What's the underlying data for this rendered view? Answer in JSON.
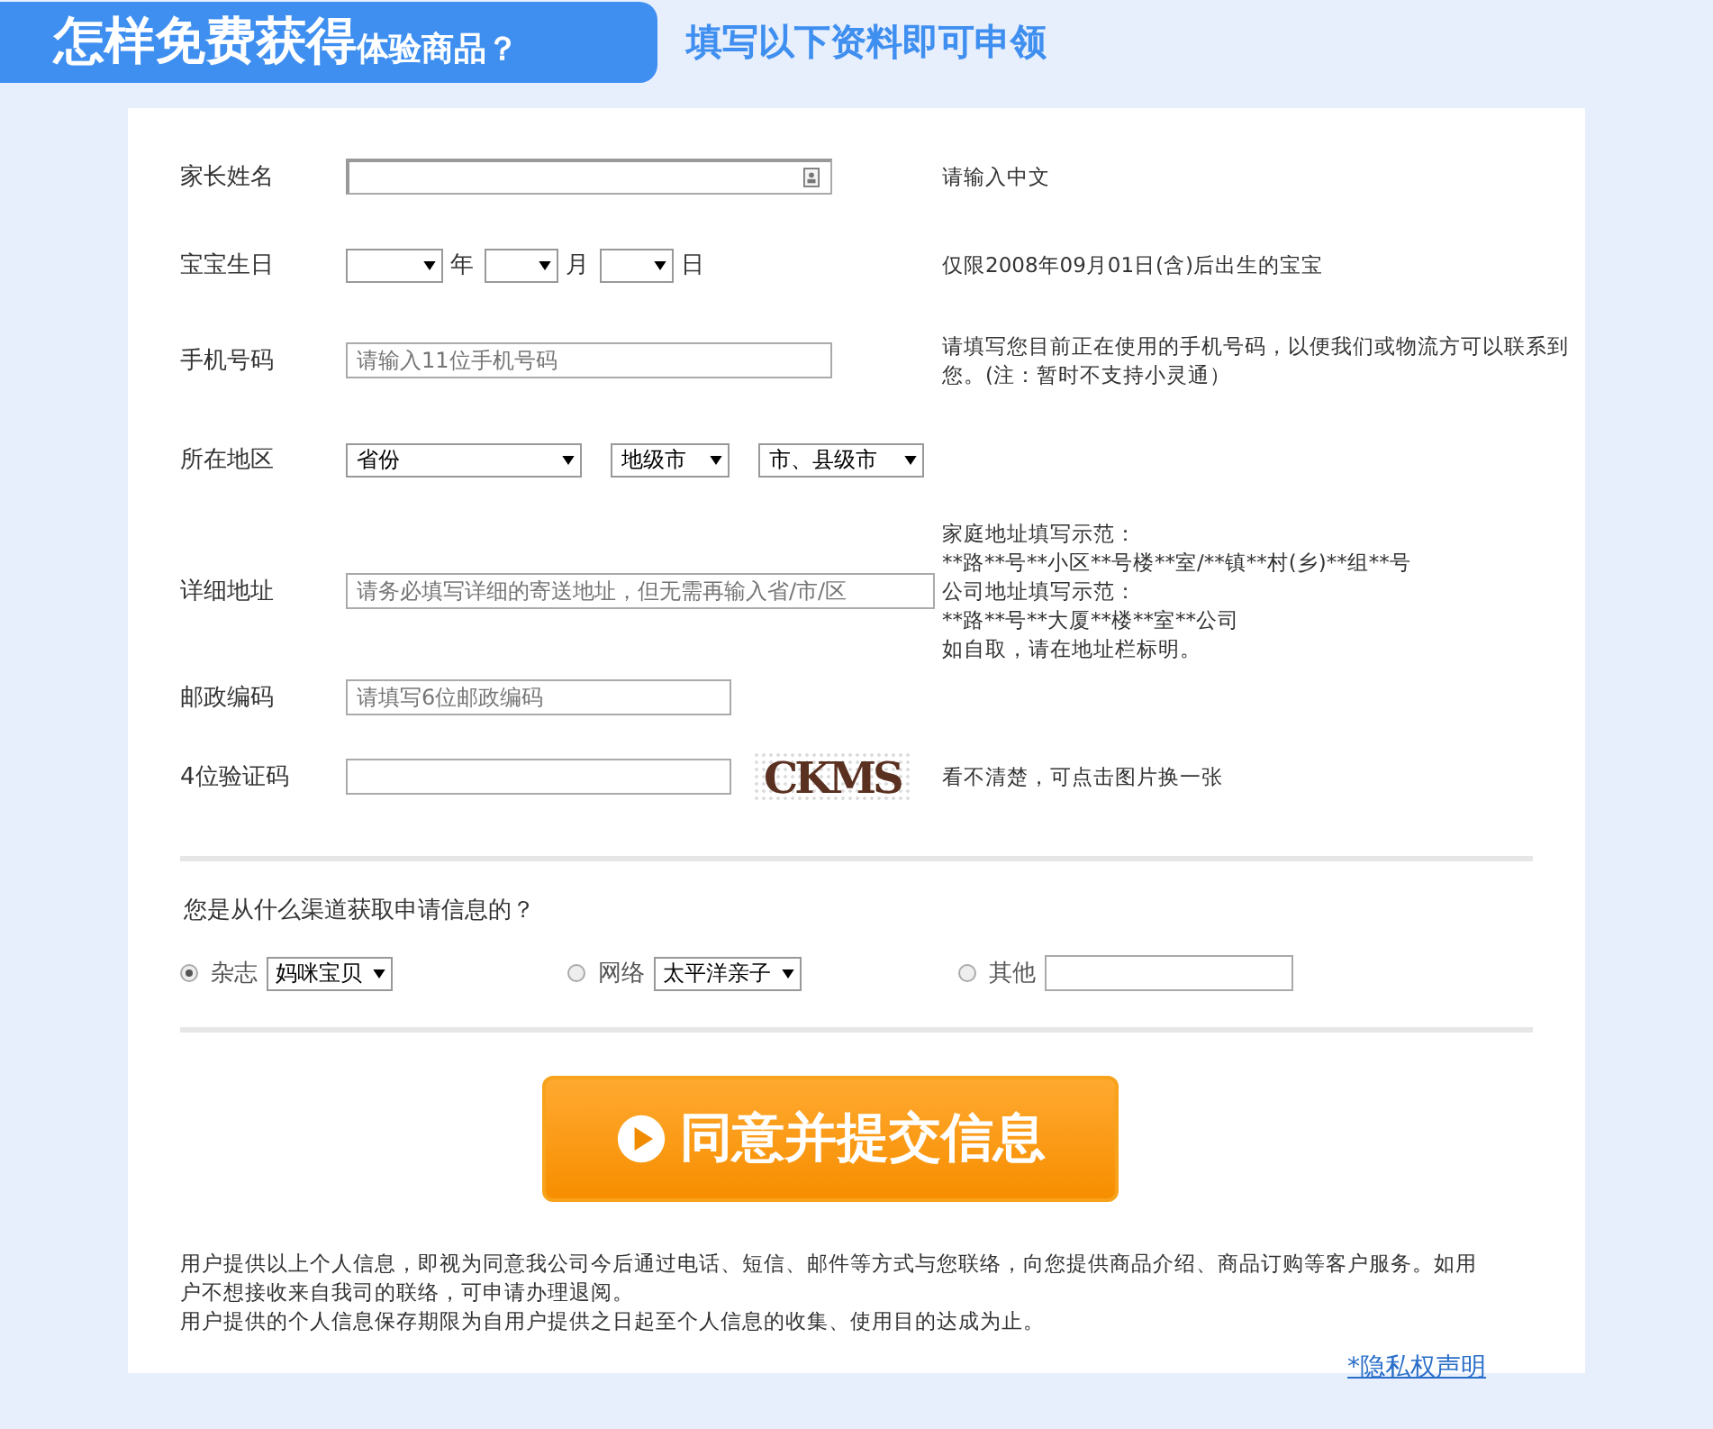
{
  "header": {
    "title_large": "怎样免费获得",
    "title_small": "体验商品？",
    "subtitle": "填写以下资料即可申领"
  },
  "form": {
    "rows": [
      {
        "kind": "name",
        "label": "家长姓名",
        "hint": [
          "请输入中文"
        ]
      },
      {
        "kind": "date",
        "label": "宝宝生日",
        "units": [
          "年",
          "月",
          "日"
        ],
        "hint": [
          "仅限2008年09月01日(含)后出生的宝宝"
        ]
      },
      {
        "kind": "input",
        "label": "手机号码",
        "placeholder": "请输入11位手机号码",
        "hint": [
          "请填写您目前正在使用的手机号码，以便我们或物流方可以联系到您。(注：暂时不支持小灵通）"
        ]
      },
      {
        "kind": "region",
        "label": "所在地区",
        "selects": [
          "省份",
          "地级市",
          "市、县级市"
        ],
        "hint": []
      },
      {
        "kind": "address",
        "label": "详细地址",
        "placeholder": "请务必填写详细的寄送地址，但无需再输入省/市/区",
        "hint": [
          "家庭地址填写示范：",
          "**路**号**小区**号楼**室/**镇**村(乡)**组**号",
          "公司地址填写示范：",
          "**路**号**大厦**楼**室**公司",
          "如自取，请在地址栏标明。"
        ]
      },
      {
        "kind": "postal",
        "label": "邮政编码",
        "placeholder": "请填写6位邮政编码",
        "hint": []
      },
      {
        "kind": "captcha",
        "label": "4位验证码",
        "captcha": "CKMS",
        "hint": [
          "看不清楚，可点击图片换一张"
        ]
      }
    ]
  },
  "source": {
    "question": "您是从什么渠道获取申请信息的？",
    "options": [
      {
        "kind": "select",
        "label": "杂志",
        "selected": true,
        "value": "妈咪宝贝"
      },
      {
        "kind": "select",
        "label": "网络",
        "selected": false,
        "value": "太平洋亲子"
      },
      {
        "kind": "input",
        "label": "其他",
        "selected": false
      }
    ]
  },
  "submit": "同意并提交信息",
  "notice": [
    "用户提供以上个人信息，即视为同意我公司今后通过电话、短信、邮件等方式与您联络，向您提供商品介绍、商品订购等客户服务。如用户不想接收来自我司的联络，可申请办理退阅。",
    "用户提供的个人信息保存期限为自用户提供之日起至个人信息的收集、使用目的达成为止。"
  ],
  "privacy_link": "*隐私权声明"
}
